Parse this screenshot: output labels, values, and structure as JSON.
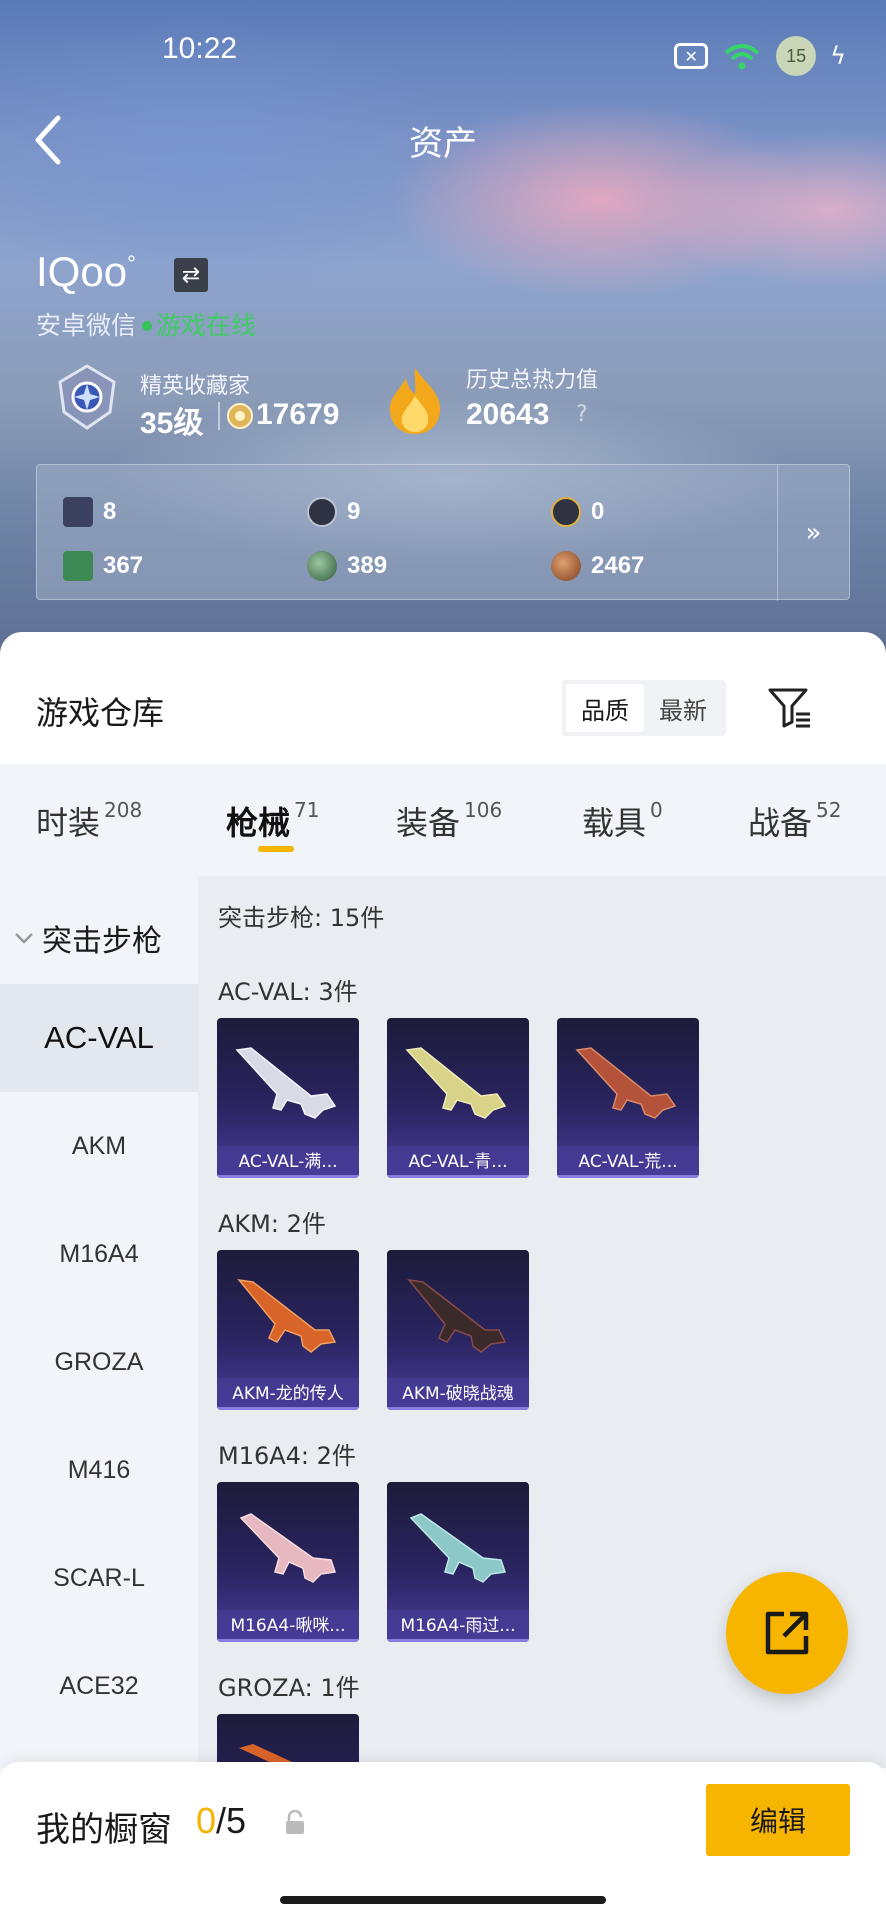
{
  "status": {
    "time": "10:22",
    "battery": "15"
  },
  "nav": {
    "title": "资产"
  },
  "user": {
    "name": "IQoo",
    "name_mark": "°",
    "platform": "安卓微信",
    "online": "游戏在线",
    "rank_title": "精英收藏家",
    "level": "35级",
    "coins": "17679",
    "heat_title": "历史总热力值",
    "heat_value": "20643",
    "heat_help": "?"
  },
  "assets": [
    {
      "icon": "card-icon",
      "value": "8"
    },
    {
      "icon": "silver-coin-icon",
      "value": "9"
    },
    {
      "icon": "gold-coin-icon",
      "value": "0"
    },
    {
      "icon": "green-card-icon",
      "value": "367"
    },
    {
      "icon": "green-orb-icon",
      "value": "389"
    },
    {
      "icon": "bronze-coin-icon",
      "value": "2467"
    }
  ],
  "assets_more": "»",
  "warehouse": {
    "title": "游戏仓库",
    "sort_options": [
      "品质",
      "最新"
    ]
  },
  "categories": [
    {
      "label": "时装",
      "count": "208"
    },
    {
      "label": "枪械",
      "count": "71"
    },
    {
      "label": "装备",
      "count": "106"
    },
    {
      "label": "载具",
      "count": "0"
    },
    {
      "label": "战备",
      "count": "52"
    }
  ],
  "sidebar": {
    "group": "突击步枪",
    "items": [
      "AC-VAL",
      "AKM",
      "M16A4",
      "GROZA",
      "M416",
      "SCAR-L",
      "ACE32"
    ]
  },
  "content": {
    "summary": "突击步枪: 15件",
    "sections": [
      {
        "title": "AC-VAL: 3件",
        "items": [
          "AC-VAL-满...",
          "AC-VAL-青...",
          "AC-VAL-荒..."
        ]
      },
      {
        "title": "AKM: 2件",
        "items": [
          "AKM-龙的传人",
          "AKM-破晓战魂"
        ]
      },
      {
        "title": "M16A4: 2件",
        "items": [
          "M16A4-啾咪...",
          "M16A4-雨过..."
        ]
      },
      {
        "title": "GROZA: 1件",
        "items": [
          ""
        ]
      }
    ]
  },
  "showcase": {
    "title": "我的橱窗",
    "current": "0",
    "total": "/5",
    "edit": "编辑"
  }
}
